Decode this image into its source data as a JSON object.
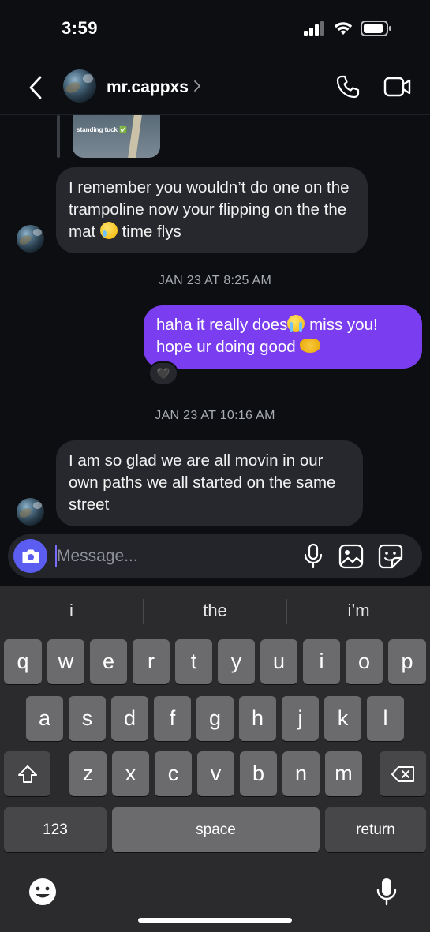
{
  "status_bar": {
    "time": "3:59"
  },
  "header": {
    "username": "mr.cappxs",
    "icons": [
      "back-chevron-icon",
      "chevron-right-icon",
      "phone-icon",
      "video-camera-icon"
    ]
  },
  "shared_post": {
    "caption": "standing tuck ✅"
  },
  "messages": [
    {
      "direction": "incoming",
      "text_a": "I remember you wouldn’t do one on the trampoline now your flipping on the the mat ",
      "text_b": " time flys"
    },
    {
      "timestamp": "JAN 23 AT 8:25 AM"
    },
    {
      "direction": "outgoing",
      "text_a": "haha it really does",
      "text_b": " miss you! hope ur doing good ",
      "reaction": "🖤"
    },
    {
      "timestamp": "JAN 23 AT 10:16 AM"
    },
    {
      "direction": "incoming",
      "text": "I am so glad we are all movin in our own paths we all started on the same street"
    }
  ],
  "composer": {
    "placeholder": "Message..."
  },
  "keyboard": {
    "suggestions": [
      "i",
      "the",
      "i’m"
    ],
    "row1": [
      "q",
      "w",
      "e",
      "r",
      "t",
      "y",
      "u",
      "i",
      "o",
      "p"
    ],
    "row2": [
      "a",
      "s",
      "d",
      "f",
      "g",
      "h",
      "j",
      "k",
      "l"
    ],
    "row3": [
      "z",
      "x",
      "c",
      "v",
      "b",
      "n",
      "m"
    ],
    "numbers_label": "123",
    "space_label": "space",
    "return_label": "return"
  },
  "colors": {
    "outgoing_bubble": "#7a3df0",
    "incoming_bubble": "#26282e",
    "camera_button": "#5b5cf0"
  }
}
